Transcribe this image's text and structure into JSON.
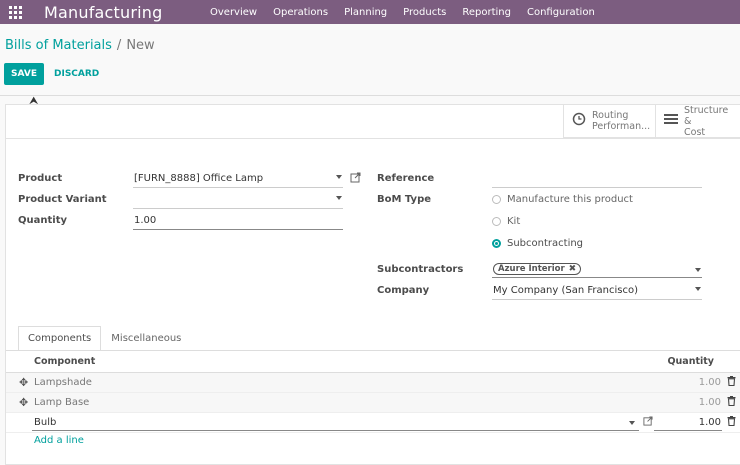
{
  "navbar": {
    "app_title": "Manufacturing",
    "menu": [
      "Overview",
      "Operations",
      "Planning",
      "Products",
      "Reporting",
      "Configuration"
    ],
    "background": "#7c5d80"
  },
  "breadcrumb": {
    "parent": "Bills of Materials",
    "separator": "/",
    "current": "New"
  },
  "actions": {
    "save": "SAVE",
    "discard": "DISCARD"
  },
  "smart_buttons": {
    "routing": {
      "line1": "Routing",
      "line2": "Performan...",
      "icon": "clock-icon"
    },
    "structure": {
      "line1": "Structure &",
      "line2": "Cost",
      "icon": "list-icon"
    }
  },
  "form": {
    "product_label": "Product",
    "product_value": "[FURN_8888] Office Lamp",
    "variant_label": "Product Variant",
    "variant_value": "",
    "quantity_label": "Quantity",
    "quantity_value": "1.00",
    "reference_label": "Reference",
    "reference_value": "",
    "bom_type_label": "BoM Type",
    "bom_type_options": [
      "Manufacture this product",
      "Kit",
      "Subcontracting"
    ],
    "bom_type_selected": "Subcontracting",
    "subcontractors_label": "Subcontractors",
    "subcontractors_tag": "Azure Interior",
    "company_label": "Company",
    "company_value": "My Company (San Francisco)"
  },
  "tabs": [
    "Components",
    "Miscellaneous"
  ],
  "active_tab": "Components",
  "table": {
    "col_component": "Component",
    "col_quantity": "Quantity",
    "rows": [
      {
        "component": "Lampshade",
        "quantity": "1.00"
      },
      {
        "component": "Lamp Base",
        "quantity": "1.00"
      },
      {
        "component": "Bulb",
        "quantity": "1.00"
      }
    ],
    "add_line": "Add a line"
  },
  "accent": "#00a09d"
}
